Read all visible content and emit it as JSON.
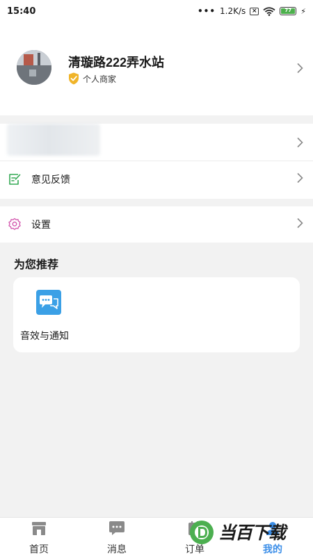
{
  "status_bar": {
    "time": "15:40",
    "network_speed": "1.2K/s",
    "battery": "77"
  },
  "profile": {
    "store_name": "清璇路222弄水站",
    "merchant_type": "个人商家"
  },
  "menu": {
    "feedback_label": "意见反馈",
    "settings_label": "设置"
  },
  "recommend": {
    "title": "为您推荐",
    "items": [
      {
        "label": "音效与通知",
        "icon": "chat-bubbles-icon"
      }
    ]
  },
  "tab_bar": {
    "tabs": [
      {
        "label": "首页",
        "icon": "store-icon"
      },
      {
        "label": "消息",
        "icon": "message-icon"
      },
      {
        "label": "订单",
        "icon": "order-icon"
      },
      {
        "label": "我的",
        "icon": "profile-icon",
        "active": true
      }
    ]
  },
  "watermark": {
    "text": "当百下载"
  },
  "colors": {
    "accent_blue": "#3b8ee8",
    "feedback_green": "#33a853",
    "settings_pink": "#d45bb0",
    "shield_gold": "#f0b429",
    "chat_icon_blue": "#3ba0e6"
  }
}
